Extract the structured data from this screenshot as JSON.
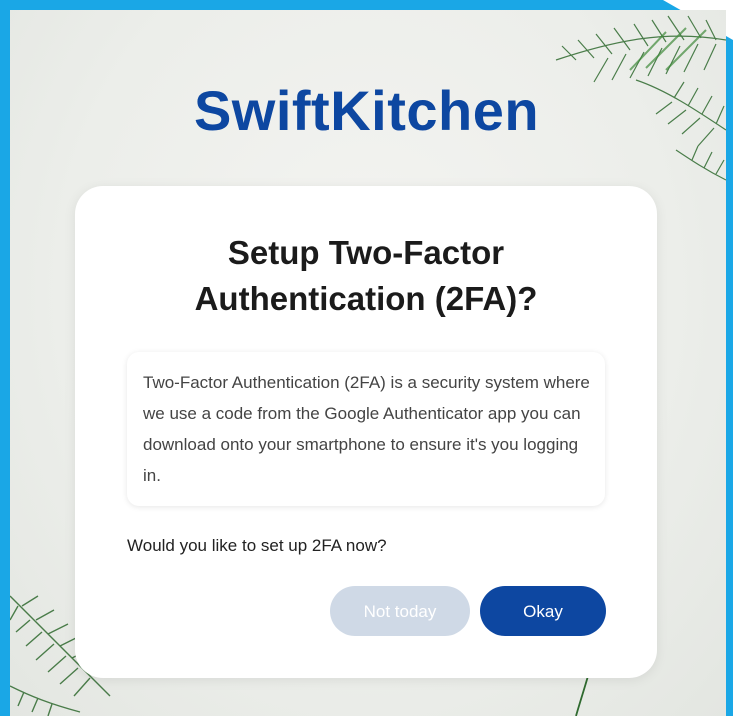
{
  "app": {
    "brand": "SwiftKitchen"
  },
  "dialog": {
    "title_line1": "Setup Two-Factor",
    "title_line2": "Authentication (2FA)?",
    "info_text": "Two-Factor Authentication (2FA) is a security system where we use a code from the Google Authenticator app you can download onto your smartphone to ensure it's you logging in.",
    "question": "Would you like to set up 2FA now?",
    "secondary_button": "Not today",
    "primary_button": "Okay"
  },
  "colors": {
    "brand": "#0d47a1",
    "frame": "#1aa7e6",
    "secondary_button": "#cfd9e6",
    "primary_button": "#0d47a1"
  },
  "icons": {
    "decor_top_right": "palm-leaf-decoration",
    "decor_bottom_left": "palm-leaf-decoration"
  }
}
